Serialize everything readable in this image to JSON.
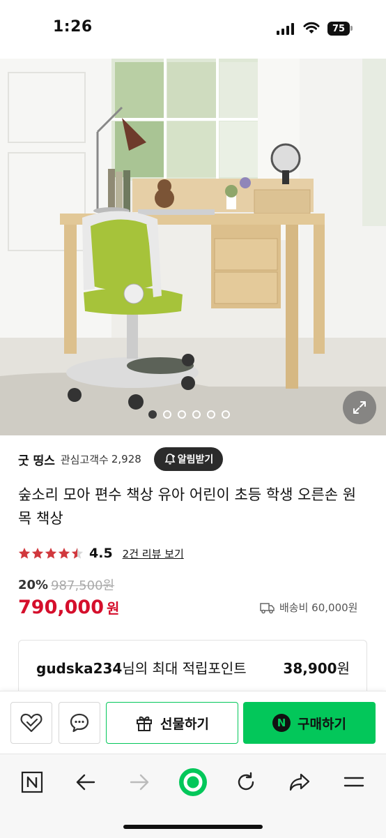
{
  "status_bar": {
    "time": "1:26",
    "battery": "75"
  },
  "gallery": {
    "total_images": 6,
    "active_index": 0
  },
  "store": {
    "name": "굿 띵스",
    "watchers_label": "관심고객수",
    "watchers_count": "2,928",
    "alarm_button": "알림받기"
  },
  "product": {
    "title": "숲소리 모아 편수 책상 유아 어린이 초등 학생 오른손 원목 책상",
    "rating": "4.5",
    "rating_stars": 4.5,
    "review_link": "2건 리뷰 보기",
    "discount": "20%",
    "original_price": "987,500원",
    "price": "790,000",
    "currency": "원",
    "shipping": "배송비 60,000원"
  },
  "points": {
    "user": "gudska234",
    "label": "님의 최대 적립포인트",
    "value": "38,900",
    "unit": "원"
  },
  "actions": {
    "gift": "선물하기",
    "buy": "구매하기",
    "buy_badge": "N"
  },
  "colors": {
    "accent_green": "#03c75a",
    "price_red": "#d50f2c",
    "star_red": "#d1383d"
  }
}
